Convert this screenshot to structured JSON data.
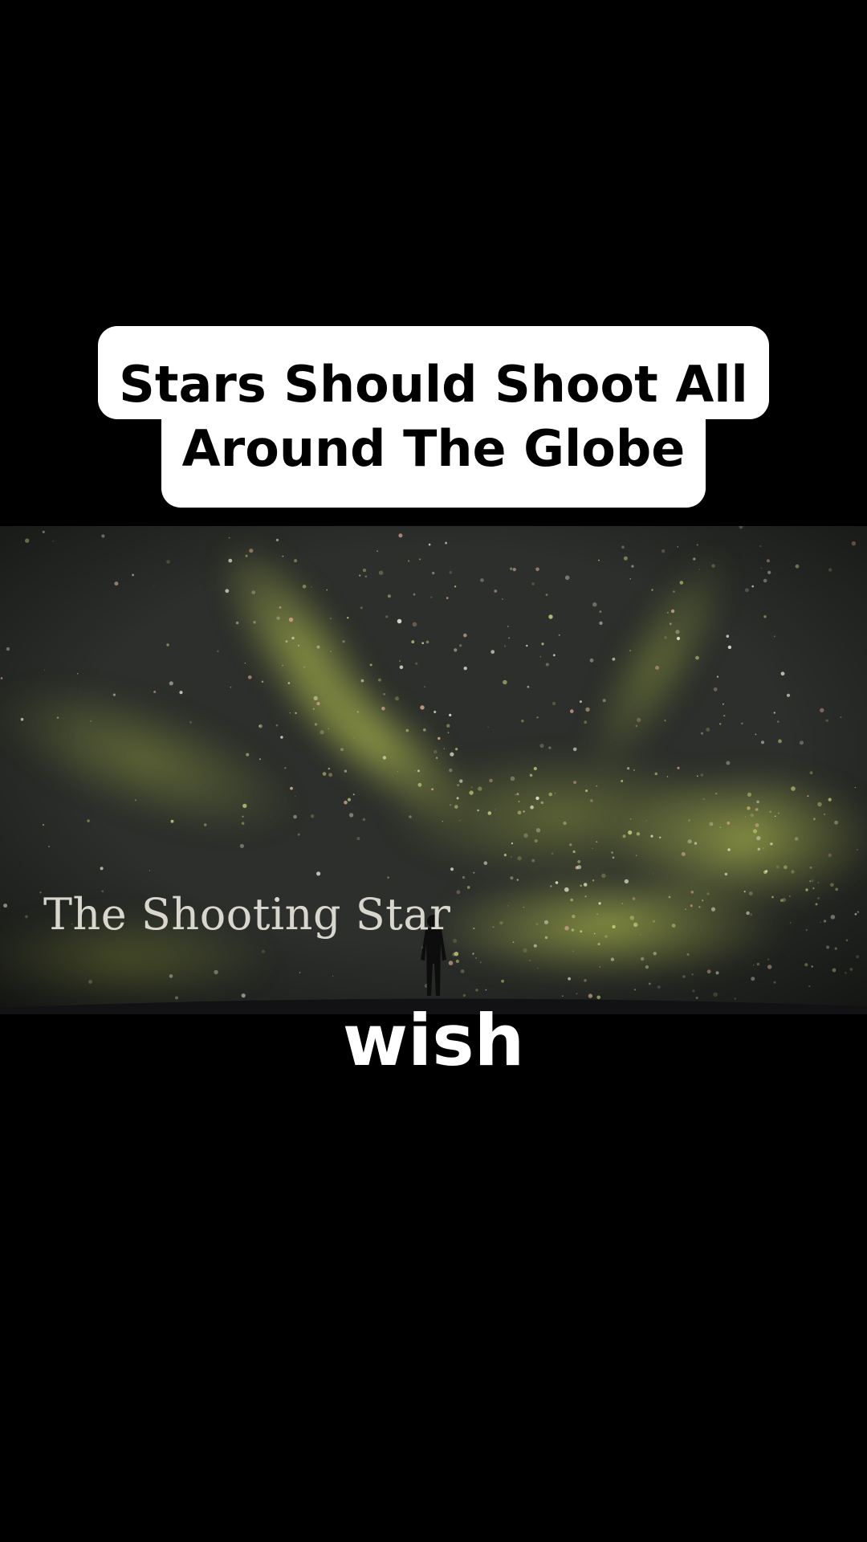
{
  "caption": {
    "line1": "Stars Should Shoot All",
    "line2": "Around The Globe"
  },
  "video": {
    "overlay_title": "The Shooting Star",
    "subtitle_word": "wish"
  },
  "colors": {
    "background": "#000000",
    "caption_bg": "#ffffff",
    "caption_text": "#000000",
    "subtitle_text": "#ffffff",
    "sky_dark": "#2b2e2a",
    "nebula_green": "#9aa84a"
  }
}
